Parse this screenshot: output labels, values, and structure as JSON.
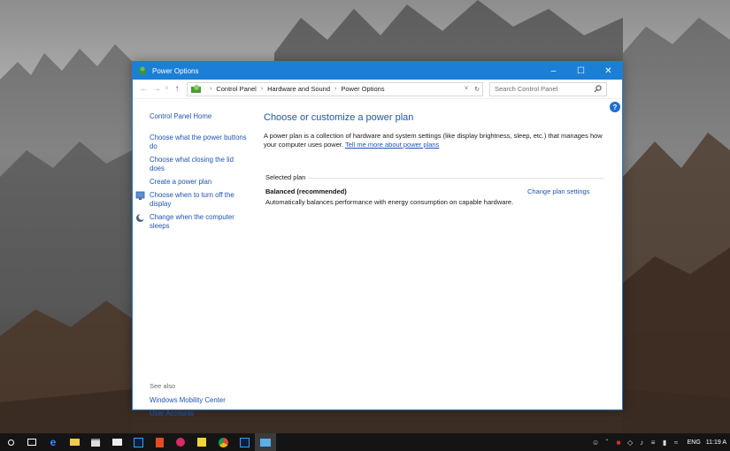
{
  "window": {
    "title": "Power Options",
    "controls": {
      "minimize": "–",
      "maximize": "☐",
      "close": "✕"
    }
  },
  "address": {
    "back": "←",
    "forward": "→",
    "recent": "˅",
    "up": "↑",
    "crumbs": [
      "Control Panel",
      "Hardware and Sound",
      "Power Options"
    ],
    "separator": "›",
    "dropdown": "˅",
    "refresh": "↻",
    "search_placeholder": "Search Control Panel"
  },
  "sidebar": {
    "home": "Control Panel Home",
    "links": [
      {
        "label": "Choose what the power buttons do",
        "icon": "none"
      },
      {
        "label": "Choose what closing the lid does",
        "icon": "none"
      },
      {
        "label": "Create a power plan",
        "icon": "none"
      },
      {
        "label": "Choose when to turn off the display",
        "icon": "monitor-icon"
      },
      {
        "label": "Change when the computer sleeps",
        "icon": "moon-icon"
      }
    ],
    "see_also": "See also",
    "see_also_links": [
      "Windows Mobility Center",
      "User Accounts"
    ]
  },
  "main": {
    "heading": "Choose or customize a power plan",
    "description": "A power plan is a collection of hardware and system settings (like display brightness, sleep, etc.) that manages how your computer uses power.",
    "description_link": "Tell me more about power plans",
    "selected_plan_label": "Selected plan",
    "plan_name": "Balanced (recommended)",
    "plan_description": "Automatically balances performance with energy consumption on capable hardware.",
    "change_plan_link": "Change plan settings",
    "help": "?"
  },
  "taskbar": {
    "icons": [
      "start-icon",
      "search-icon",
      "task-view-icon",
      "edge-icon",
      "file-explorer-icon",
      "store-icon",
      "mail-icon",
      "photoshop-icon",
      "office-icon",
      "app-icon",
      "sticky-notes-icon",
      "chrome-icon",
      "photoshop-icon-2",
      "control-panel-icon"
    ],
    "tray": {
      "language": "ENG",
      "time": "11:19 A"
    }
  },
  "colors": {
    "title_bar": "#1b7fd6",
    "link": "#1e55b0",
    "taskbar": "#141414"
  }
}
